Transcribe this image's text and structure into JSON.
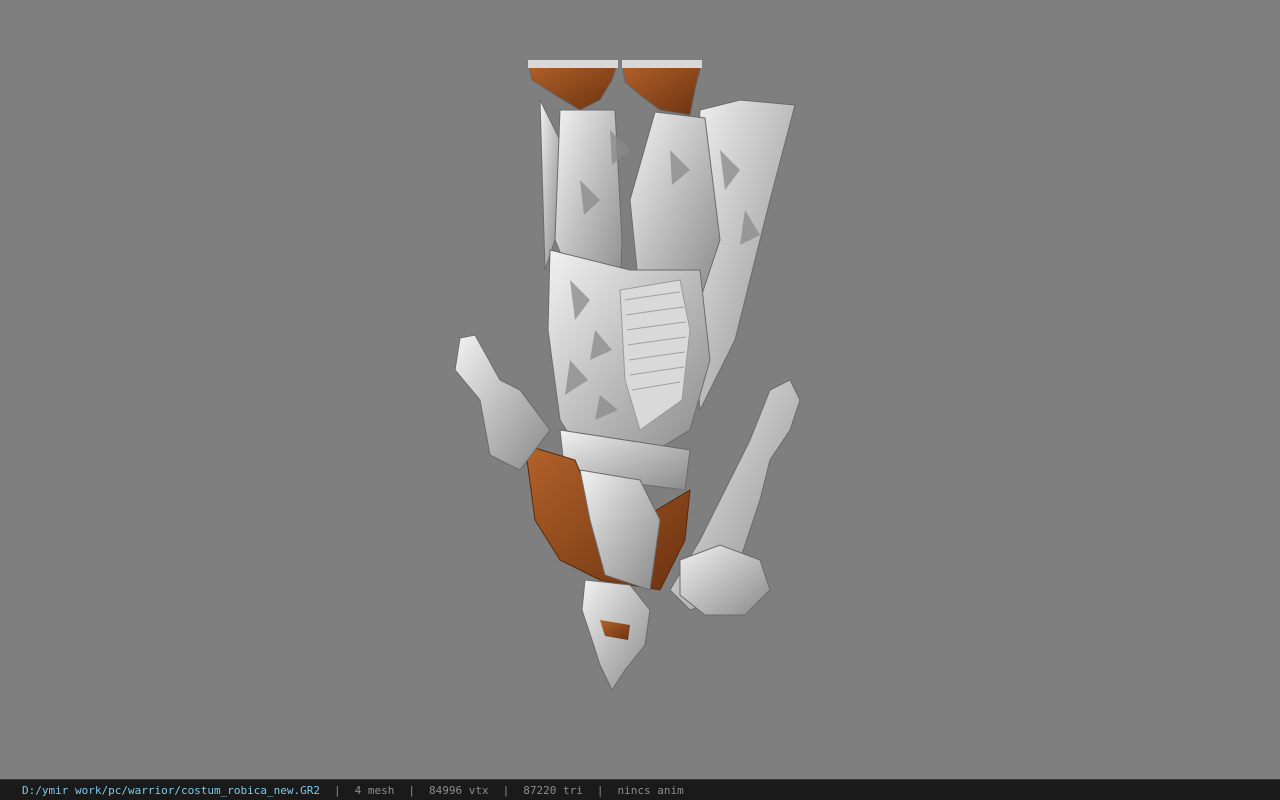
{
  "status_bar": {
    "file_path": "D:/ymir work/pc/warrior/costum_robica_new.GR2",
    "separator": "|",
    "mesh": "4 mesh",
    "vtx": "84996 vtx",
    "tri": "87220 tri",
    "anim": "nincs anim"
  },
  "colors": {
    "background": "#7f7f7f",
    "status_bar": "#1a1a1a",
    "file_path_text": "#7ec8e8",
    "status_text": "#8c8c8c"
  }
}
